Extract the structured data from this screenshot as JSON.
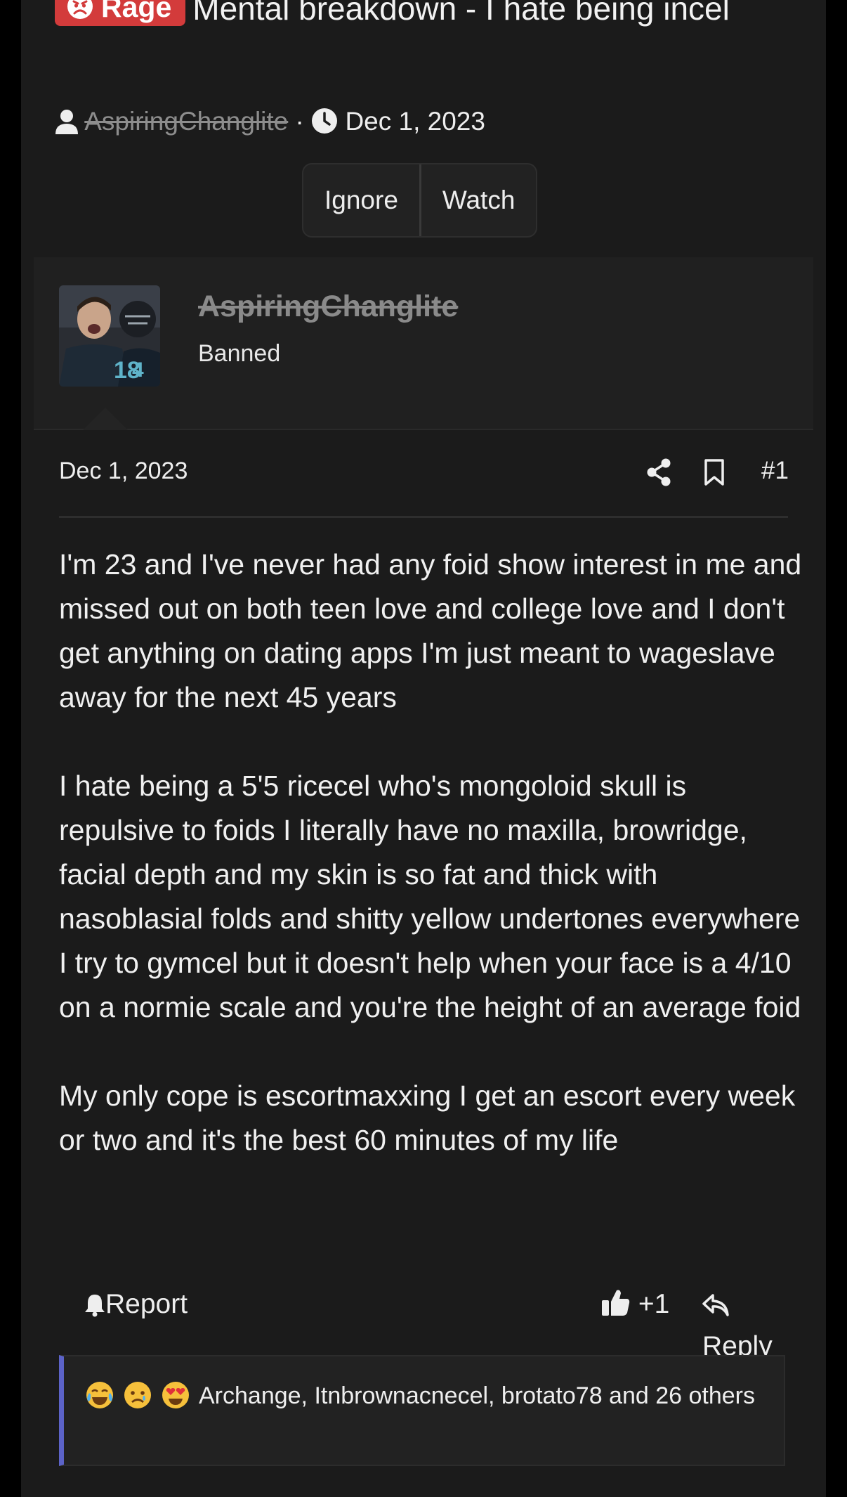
{
  "thread": {
    "prefix": "Rage",
    "title": "Mental breakdown - I hate being incel",
    "author": "AspiringChanglite",
    "date": "Dec 1, 2023",
    "separator": "·"
  },
  "thread_actions": {
    "ignore_label": "Ignore",
    "watch_label": "Watch"
  },
  "user": {
    "name": "AspiringChanglite",
    "title": "Banned"
  },
  "post": {
    "date": "Dec 1, 2023",
    "number": "#1",
    "paragraphs": [
      "I'm 23 and I've never had any foid show interest in me and missed out on both teen love and college love and I don't get anything on dating apps I'm just meant to wageslave away for the next 45 years",
      "I hate being a 5'5 ricecel who's mongoloid skull is repulsive to foids I literally have no maxilla, browridge, facial depth and my skin is so fat and thick with nasoblasial folds and shitty yellow undertones everywhere I try to gymcel but it doesn't help when your face is a 4/10 on a normie scale and you're the height of an average foid",
      "My only cope is escortmaxxing I get an escort every week or two and it's the best 60 minutes of my life"
    ]
  },
  "post_actions": {
    "report_label": "Report",
    "like_label": "+1",
    "reply_label": "Reply"
  },
  "reactions": {
    "icons": [
      "crying-laughing-emoji",
      "sad-emoji",
      "heart-eyes-emoji"
    ],
    "text": "Archange, Itnbrownacnecel, brotato78 and 26 others"
  },
  "colors": {
    "background": "#1b1b1b",
    "prefix_rage": "#d33b3b",
    "reaction_accent": "#5c63c8",
    "muted_username": "#8a8a8a"
  }
}
